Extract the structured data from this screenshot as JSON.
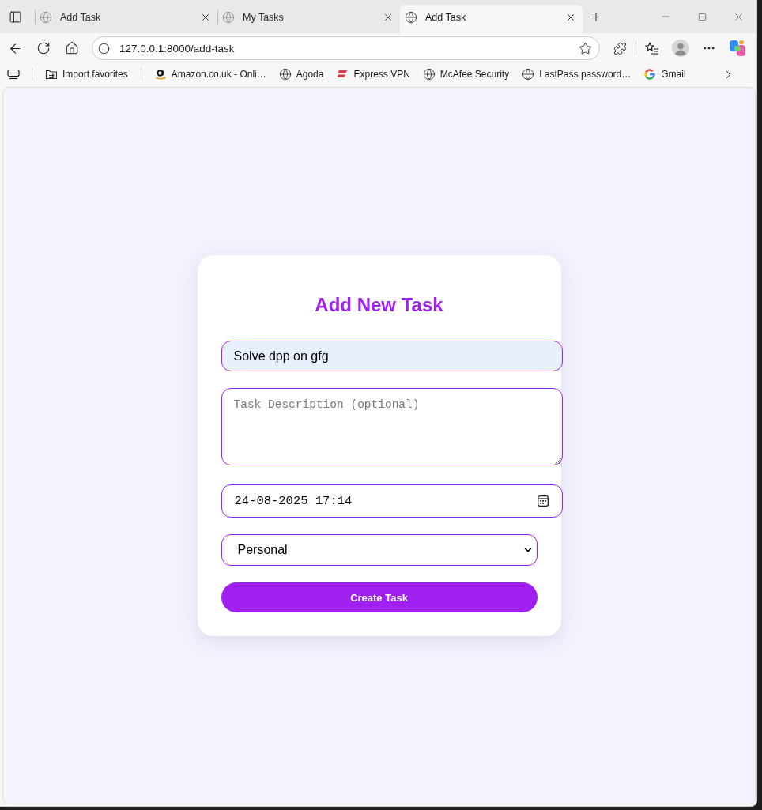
{
  "browser": {
    "tabs": [
      {
        "title": "Add Task",
        "selected": false
      },
      {
        "title": "My Tasks",
        "selected": false
      },
      {
        "title": "Add Task",
        "selected": true
      }
    ],
    "address_bar": {
      "url": "127.0.0.1:8000/add-task"
    },
    "bookmarks": [
      {
        "label": "Import favorites",
        "kind": "import"
      },
      {
        "label": "Amazon.co.uk - Onli…",
        "kind": "amazon"
      },
      {
        "label": "Agoda",
        "kind": "globe"
      },
      {
        "label": "Express VPN",
        "kind": "vpn"
      },
      {
        "label": "McAfee Security",
        "kind": "globe"
      },
      {
        "label": "LastPass password…",
        "kind": "globe"
      },
      {
        "label": "Gmail",
        "kind": "google"
      }
    ]
  },
  "form": {
    "title": "Add New Task",
    "task_title": {
      "value": "Solve dpp on gfg"
    },
    "description": {
      "placeholder": "Task Description (optional)"
    },
    "due_date": {
      "value": "24-08-2025 17:14"
    },
    "category": {
      "value": "Personal"
    },
    "submit_button": {
      "label": "Create Task"
    }
  }
}
